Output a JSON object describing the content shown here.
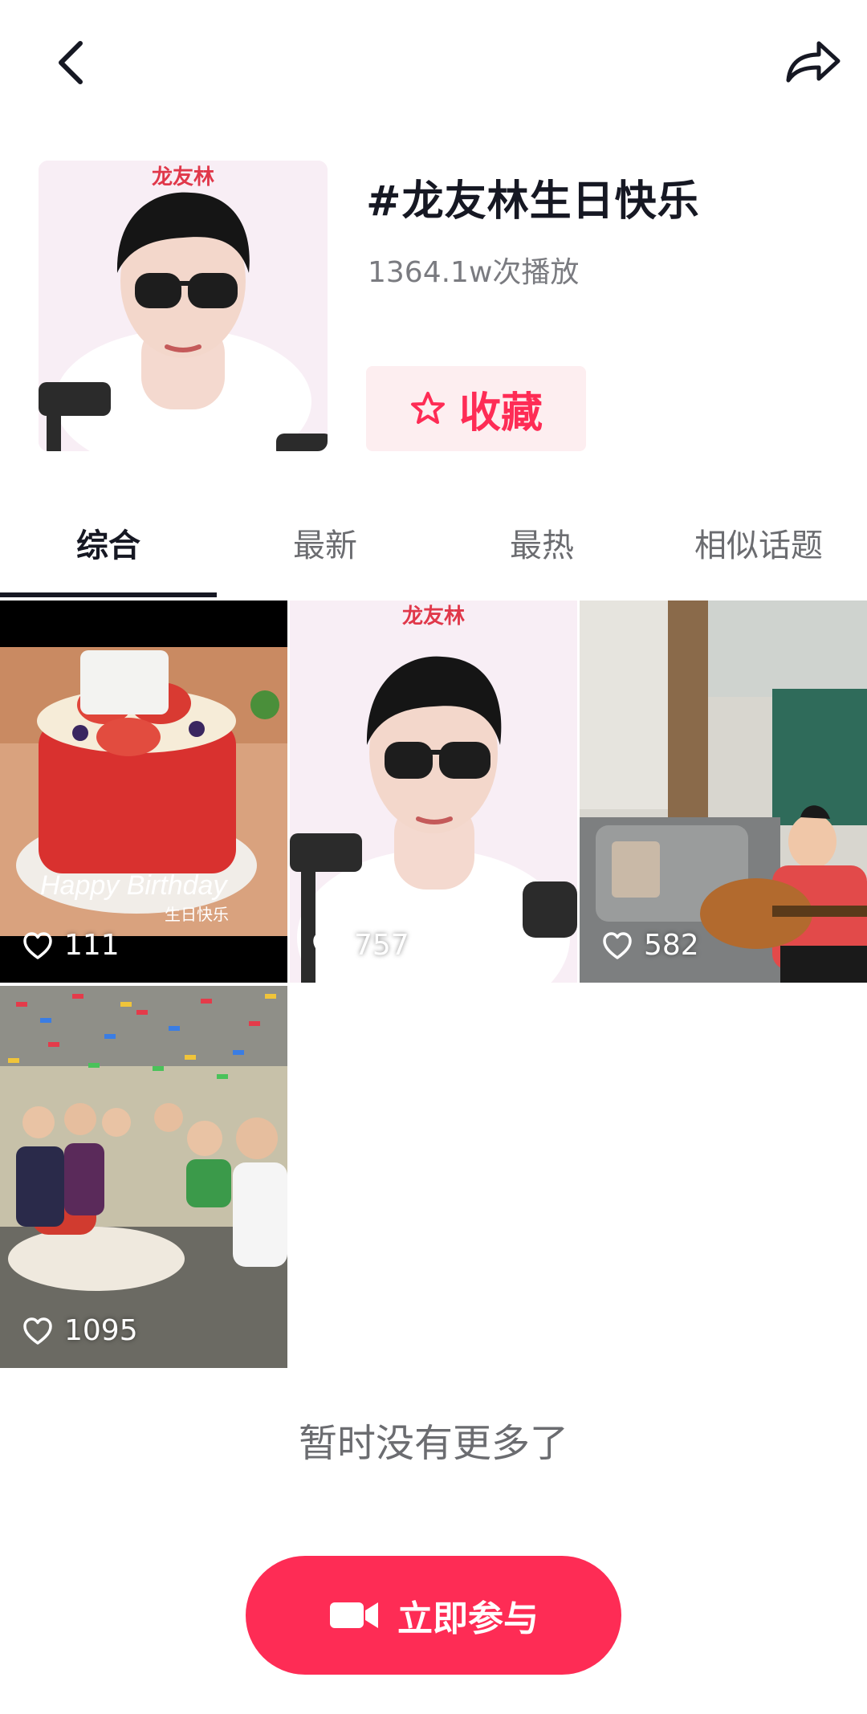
{
  "header": {
    "back_icon": "chevron-left-icon",
    "share_icon": "share-arrow-icon"
  },
  "topic": {
    "cover_caption": "龙友林",
    "title": "#龙友林生日快乐",
    "play_count": "1364.1w次播放",
    "favorite_label": "收藏",
    "favorite_icon": "star-outline-icon"
  },
  "tabs": [
    {
      "label": "综合",
      "active": true
    },
    {
      "label": "最新",
      "active": false
    },
    {
      "label": "最热",
      "active": false
    },
    {
      "label": "相似话题",
      "active": false
    }
  ],
  "videos": [
    {
      "likes": "111",
      "overlay_text": "Happy Birthday",
      "overlay_sub": "生日快乐"
    },
    {
      "likes": "757",
      "overlay_text": "龙友林"
    },
    {
      "likes": "582"
    },
    {
      "likes": "1095"
    }
  ],
  "footer": {
    "end_text": "暂时没有更多了",
    "join_label": "立即参与",
    "join_icon": "video-camera-icon"
  },
  "colors": {
    "accent": "#fe2c55",
    "text_primary": "#161823",
    "text_secondary": "#7a7b80"
  }
}
